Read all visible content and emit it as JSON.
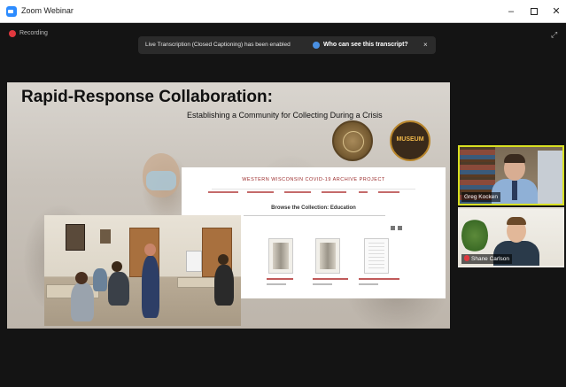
{
  "window": {
    "title": "Zoom Webinar",
    "minimize": "–",
    "close": "✕"
  },
  "recording": {
    "label": "Recording"
  },
  "banner": {
    "message": "Live Transcription (Closed Captioning) has been enabled",
    "link": "Who can see this transcript?",
    "close": "×"
  },
  "fullscreen_icon": "⤢",
  "slide": {
    "title": "Rapid-Response Collaboration:",
    "subtitle": "Establishing a Community for Collecting During a Crisis",
    "seal_text": "MUSEUM",
    "website": {
      "site_title": "WESTERN WISCONSIN COVID-19 ARCHIVE PROJECT",
      "browse_heading": "Browse the Collection: Education"
    }
  },
  "participants": [
    {
      "name": "Greg Kocken",
      "active_speaker": true,
      "muted": false
    },
    {
      "name": "Shane Carlson",
      "active_speaker": false,
      "muted": true
    }
  ],
  "colors": {
    "active_speaker_border": "#d9e021",
    "recording_dot": "#e0383e",
    "zoom_blue": "#2d8cff"
  }
}
